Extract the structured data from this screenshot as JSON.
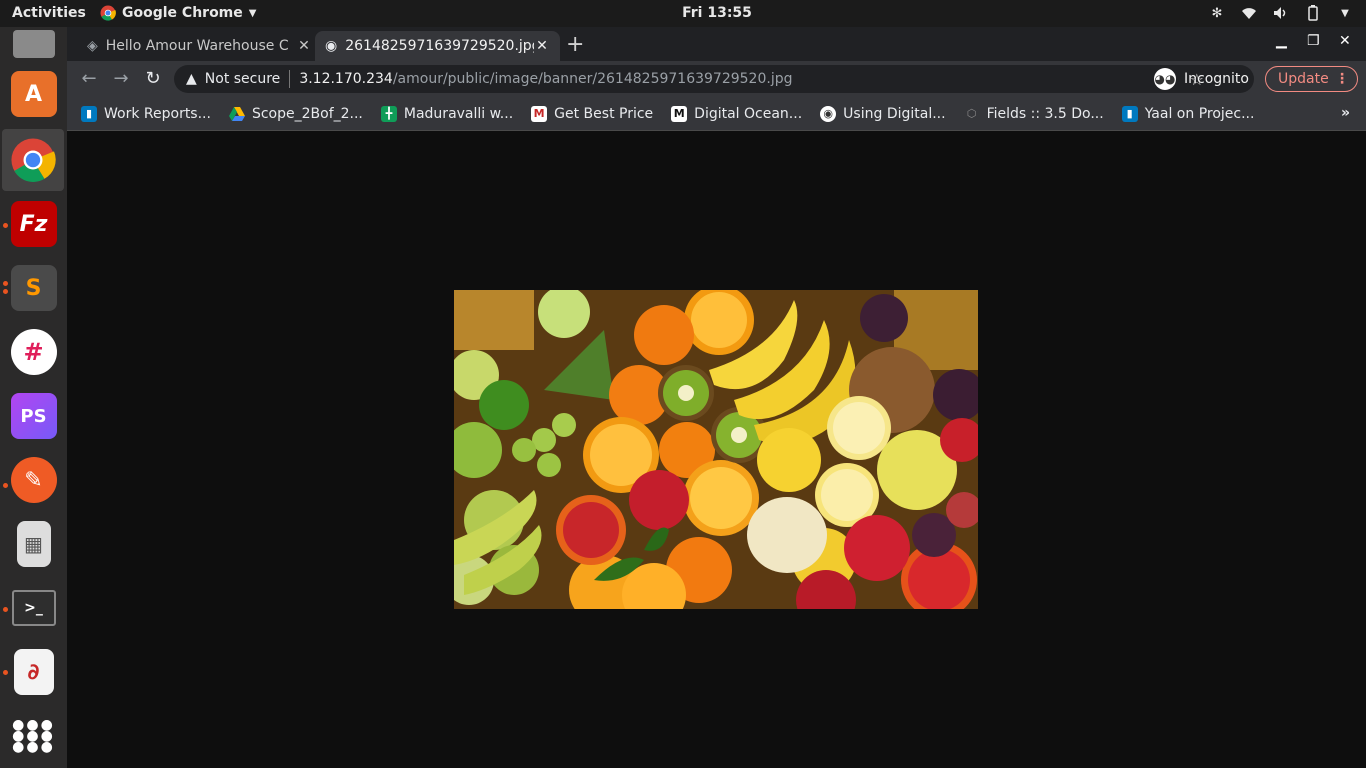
{
  "topbar": {
    "activities": "Activities",
    "app_name": "Google Chrome",
    "clock": "Fri 13:55"
  },
  "dock": {
    "items": [
      {
        "name": "files",
        "label": "Files"
      },
      {
        "name": "software",
        "label": "Ubuntu Software"
      },
      {
        "name": "chrome",
        "label": "Google Chrome"
      },
      {
        "name": "filezilla",
        "label": "FileZilla"
      },
      {
        "name": "sublime",
        "label": "Sublime Text"
      },
      {
        "name": "slack",
        "label": "Slack"
      },
      {
        "name": "phpstorm",
        "label": "PhpStorm"
      },
      {
        "name": "postman",
        "label": "Postman"
      },
      {
        "name": "calculator",
        "label": "Calculator"
      },
      {
        "name": "terminal",
        "label": "Terminal"
      },
      {
        "name": "document-viewer",
        "label": "Document Viewer"
      },
      {
        "name": "show-apps",
        "label": "Show Applications"
      }
    ]
  },
  "tabs": [
    {
      "title": "Hello Amour Warehouse C",
      "active": false
    },
    {
      "title": "2614825971639729520.jpg",
      "active": true
    }
  ],
  "toolbar": {
    "security": "Not secure",
    "url_host": "3.12.170.234",
    "url_path": "/amour/public/image/banner/2614825971639729520.jpg",
    "incognito": "Incognito",
    "update": "Update"
  },
  "bookmarks": [
    {
      "label": "Work Reports...",
      "color": "#0079bf",
      "icon": "trello-icon"
    },
    {
      "label": "Scope_2Bof_2...",
      "color": "#1fa463",
      "icon": "drive-icon"
    },
    {
      "label": "Maduravalli w...",
      "color": "#0f9d58",
      "icon": "sheets-icon"
    },
    {
      "label": "Get Best Price",
      "color": "#c62828",
      "icon": "price-icon"
    },
    {
      "label": "Digital Ocean...",
      "color": "#111111",
      "icon": "medium-icon"
    },
    {
      "label": "Using Digital...",
      "color": "#555555",
      "icon": "globe-icon"
    },
    {
      "label": "Fields :: 3.5 Do...",
      "color": "#6b6b6b",
      "icon": "fields-icon"
    },
    {
      "label": "Yaal on Projec...",
      "color": "#0079bf",
      "icon": "trello-icon"
    }
  ],
  "viewport": {
    "image_alt": "Assorted fresh fruits banner"
  }
}
